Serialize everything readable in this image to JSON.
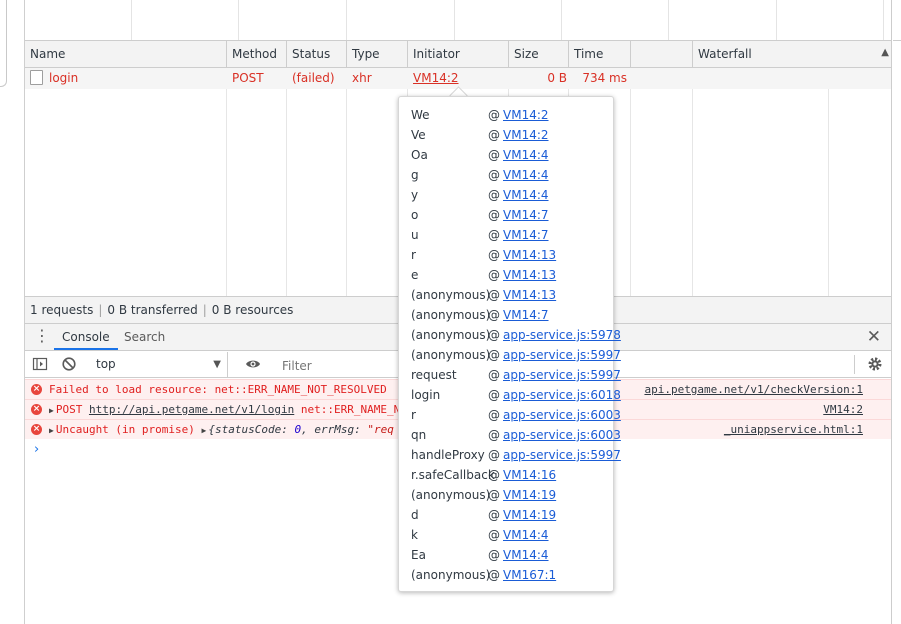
{
  "network": {
    "columns": [
      "Name",
      "Method",
      "Status",
      "Type",
      "Initiator",
      "Size",
      "Time",
      "",
      "Waterfall"
    ],
    "request": {
      "name": "login",
      "method": "POST",
      "status": "(failed)",
      "type": "xhr",
      "initiator": "VM14:2",
      "size": "0 B",
      "time": "734 ms"
    },
    "summary": {
      "requests": "1 requests",
      "transferred": "0 B transferred",
      "resources": "0 B resources"
    }
  },
  "drawer": {
    "tabs": [
      "Console",
      "Search"
    ],
    "active_tab": "Console"
  },
  "console": {
    "context": "top",
    "filter_placeholder": "Filter",
    "messages": [
      {
        "text": "Failed to load resource: net::ERR_NAME_NOT_RESOLVED",
        "source": "api.petgame.net/v1/checkVersion:1"
      },
      {
        "prefix": "POST ",
        "url": "http://api.petgame.net/v1/login",
        "suffix": " net::ERR_NAME_N",
        "source": "VM14:2"
      },
      {
        "prefix": "Uncaught (in promise) ",
        "obj_open": "{",
        "key1": "statusCode:",
        "val1": "0",
        "comma": ", ",
        "key2": "errMsg:",
        "val2": " \"req",
        "source": "_uniappservice.html:1"
      }
    ],
    "prompt": "›"
  },
  "initiator_stack": [
    {
      "fn": "We",
      "loc": "VM14:2"
    },
    {
      "fn": "Ve",
      "loc": "VM14:2"
    },
    {
      "fn": "Oa",
      "loc": "VM14:4"
    },
    {
      "fn": "g",
      "loc": "VM14:4"
    },
    {
      "fn": "y",
      "loc": "VM14:4"
    },
    {
      "fn": "o",
      "loc": "VM14:7"
    },
    {
      "fn": "u",
      "loc": "VM14:7"
    },
    {
      "fn": "r",
      "loc": "VM14:13"
    },
    {
      "fn": "e",
      "loc": "VM14:13"
    },
    {
      "fn": "(anonymous)",
      "loc": "VM14:13"
    },
    {
      "fn": "(anonymous)",
      "loc": "VM14:7"
    },
    {
      "fn": "(anonymous)",
      "loc": "app-service.js:5978"
    },
    {
      "fn": "(anonymous)",
      "loc": "app-service.js:5997"
    },
    {
      "fn": "request",
      "loc": "app-service.js:5997"
    },
    {
      "fn": "login",
      "loc": "app-service.js:6018"
    },
    {
      "fn": "r",
      "loc": "app-service.js:6003"
    },
    {
      "fn": "qn",
      "loc": "app-service.js:6003"
    },
    {
      "fn": "handleProxy",
      "loc": "app-service.js:5997"
    },
    {
      "fn": "r.safeCallback",
      "loc": "VM14:16"
    },
    {
      "fn": "(anonymous)",
      "loc": "VM14:19"
    },
    {
      "fn": "d",
      "loc": "VM14:19"
    },
    {
      "fn": "k",
      "loc": "VM14:4"
    },
    {
      "fn": "Ea",
      "loc": "VM14:4"
    },
    {
      "fn": "(anonymous)",
      "loc": "VM167:1"
    }
  ],
  "at_symbol": "@",
  "colors": {
    "error": "#d93025",
    "link": "#1a5cd6",
    "accent": "#1a73e8"
  },
  "icons": {
    "sort": "sort-ascending-icon",
    "close": "close-icon",
    "sidebar": "sidebar-toggle-icon",
    "clear": "clear-console-icon",
    "eye": "eye-icon",
    "settings": "gear-icon",
    "error": "error-icon"
  }
}
